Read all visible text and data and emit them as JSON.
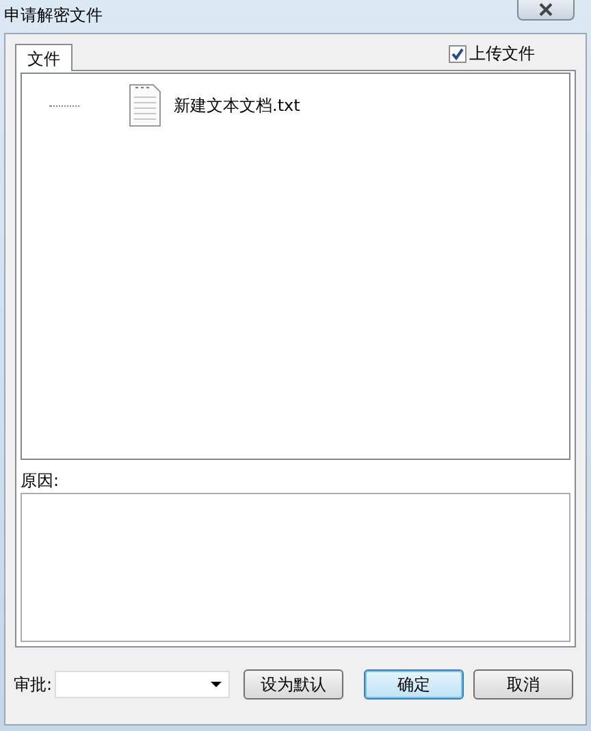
{
  "window": {
    "title": "申请解密文件"
  },
  "tabs": [
    {
      "label": "文件",
      "selected": true
    }
  ],
  "upload_checkbox": {
    "label": "上传文件",
    "checked": true
  },
  "file_tree": {
    "items": [
      {
        "name": "新建文本文档.txt",
        "selected": false
      }
    ]
  },
  "reason": {
    "label": "原因:"
  },
  "approval": {
    "label": "审批:"
  },
  "buttons": [
    {
      "label": "设为默认",
      "kind": "normal"
    },
    {
      "label": "确定",
      "kind": "default"
    },
    {
      "label": "取消",
      "kind": "normal"
    }
  ]
}
